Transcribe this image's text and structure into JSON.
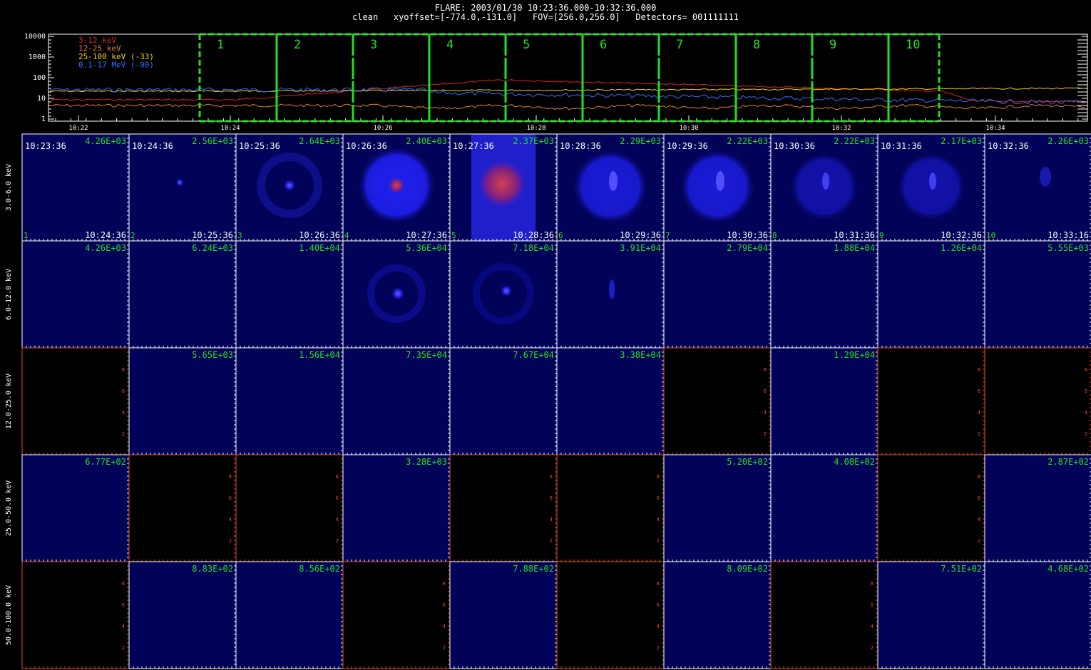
{
  "header": {
    "line1": "FLARE: 2003/01/30 10:23:36.000-10:32:36.000",
    "line2": "clean   xyoffset=[-774.0,-131.0]   FOV=[256.0,256.0]   Detectors= 001111111"
  },
  "lightcurve": {
    "y_ticks": [
      "10000",
      "1000",
      "100",
      "10",
      "1"
    ],
    "x_ticks": [
      "10:22",
      "10:24",
      "10:26",
      "10:28",
      "10:30",
      "10:32",
      "10:34"
    ],
    "legend": [
      {
        "label": "3-12 keV",
        "color": "#e02020"
      },
      {
        "label": "12-25 keV",
        "color": "#e08030"
      },
      {
        "label": "25-100 keV (-33)",
        "color": "#f0d020"
      },
      {
        "label": "0.1-17 MeV (-90)",
        "color": "#3070ff"
      }
    ],
    "intervals": [
      "1",
      "2",
      "3",
      "4",
      "5",
      "6",
      "7",
      "8",
      "9",
      "10"
    ],
    "interval_color": "#20e020"
  },
  "rows": [
    {
      "label": "3.0-6.0 keV"
    },
    {
      "label": "6.0-12.0 keV"
    },
    {
      "label": "12.0-25.0 keV"
    },
    {
      "label": "25.0-50.0 keV"
    },
    {
      "label": "50.0-100.0 keV"
    }
  ],
  "start_times": [
    "10:23:36",
    "10:24:36",
    "10:25:36",
    "10:26:36",
    "10:27:36",
    "10:28:36",
    "10:29:36",
    "10:30:36",
    "10:31:36",
    "10:32:36"
  ],
  "end_times": [
    "10:24:36",
    "10:25:36",
    "10:26:36",
    "10:27:36",
    "10:28:36",
    "10:29:36",
    "10:30:36",
    "10:31:36",
    "10:32:36",
    "10:33:16"
  ],
  "frame_numbers": [
    "1",
    "2",
    "3",
    "4",
    "5",
    "6",
    "7",
    "8",
    "9",
    "10"
  ],
  "max_values": [
    [
      "4.26E+03",
      "2.56E+03",
      "2.64E+03",
      "2.40E+03",
      "2.37E+03",
      "2.29E+03",
      "2.22E+03",
      "2.22E+03",
      "2.17E+03",
      "2.26E+03"
    ],
    [
      "4.26E+03",
      "6.24E+03",
      "1.40E+04",
      "5.36E+04",
      "7.18E+04",
      "3.91E+04",
      "2.79E+04",
      "1.88E+04",
      "1.26E+04",
      "5.55E+03"
    ],
    [
      "",
      "5.65E+03",
      "1.56E+04",
      "7.35E+04",
      "7.67E+04",
      "3.38E+04",
      "",
      "1.29E+04",
      "",
      ""
    ],
    [
      "6.77E+02",
      "",
      "",
      "3.28E+03",
      "",
      "",
      "5.20E+02",
      "4.08E+02",
      "",
      "2.87E+02"
    ],
    [
      "",
      "8.83E+02",
      "8.56E+02",
      "",
      "7.88E+02",
      "",
      "8.09E+02",
      "",
      "7.51E+02",
      "4.68E+02"
    ]
  ],
  "empty_axis_ticks": [
    "2",
    "4",
    "6",
    "8"
  ]
}
